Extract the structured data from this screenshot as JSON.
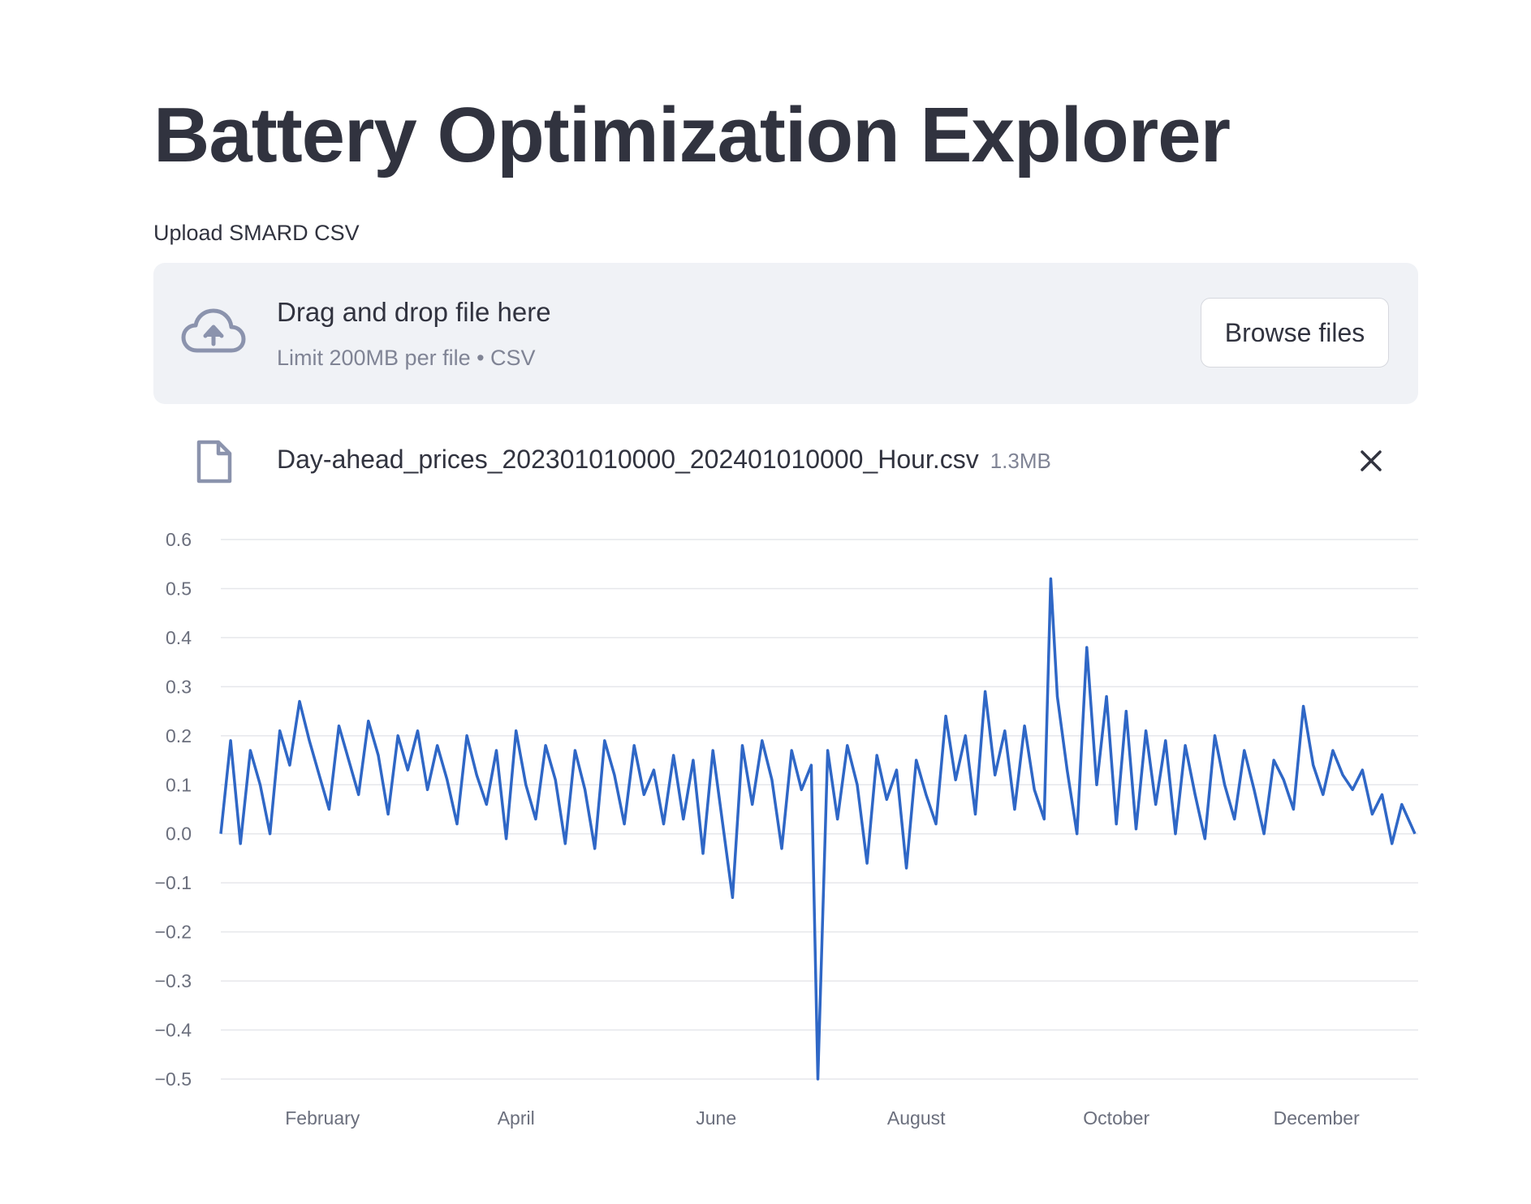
{
  "header": {
    "title": "Battery Optimization Explorer"
  },
  "uploader": {
    "label": "Upload SMARD CSV",
    "drop_text": "Drag and drop file here",
    "limit_text": "Limit 200MB per file • CSV",
    "browse_label": "Browse files",
    "icons": {
      "dropzone": "cloud-upload-icon",
      "file": "file-icon",
      "remove": "close-icon"
    }
  },
  "uploaded_file": {
    "name": "Day-ahead_prices_202301010000_202401010000_Hour.csv",
    "size": "1.3MB"
  },
  "colors": {
    "accent_line": "#2f67c6",
    "dropzone_bg": "#f0f2f6",
    "text": "#31333f",
    "muted_text": "#808495"
  },
  "chart_data": {
    "type": "line",
    "title": "",
    "xlabel": "",
    "ylabel": "",
    "x_range": [
      "2023-01-01",
      "2024-01-01"
    ],
    "ylim": [
      -0.5,
      0.6
    ],
    "y_ticks": [
      0.6,
      0.5,
      0.4,
      0.3,
      0.2,
      0.1,
      0.0,
      -0.1,
      -0.2,
      -0.3,
      -0.4,
      -0.5
    ],
    "y_tick_labels": [
      "0.6",
      "0.5",
      "0.4",
      "0.3",
      "0.2",
      "0.1",
      "0.0",
      "−0.1",
      "−0.2",
      "−0.3",
      "−0.4",
      "−0.5"
    ],
    "x_ticks": [
      {
        "date": "2023-02-01",
        "label": "February"
      },
      {
        "date": "2023-04-01",
        "label": "April"
      },
      {
        "date": "2023-06-01",
        "label": "June"
      },
      {
        "date": "2023-08-01",
        "label": "August"
      },
      {
        "date": "2023-10-01",
        "label": "October"
      },
      {
        "date": "2023-12-01",
        "label": "December"
      }
    ],
    "grid": "horizontal",
    "legend": "none",
    "series": [
      {
        "color": "#2f67c6",
        "x": [
          "2023-01-01",
          "2023-01-04",
          "2023-01-07",
          "2023-01-10",
          "2023-01-13",
          "2023-01-16",
          "2023-01-19",
          "2023-01-22",
          "2023-01-25",
          "2023-01-28",
          "2023-01-31",
          "2023-02-03",
          "2023-02-06",
          "2023-02-09",
          "2023-02-12",
          "2023-02-15",
          "2023-02-18",
          "2023-02-21",
          "2023-02-24",
          "2023-02-27",
          "2023-03-02",
          "2023-03-05",
          "2023-03-08",
          "2023-03-11",
          "2023-03-14",
          "2023-03-17",
          "2023-03-20",
          "2023-03-23",
          "2023-03-26",
          "2023-03-29",
          "2023-04-01",
          "2023-04-04",
          "2023-04-07",
          "2023-04-10",
          "2023-04-13",
          "2023-04-16",
          "2023-04-19",
          "2023-04-22",
          "2023-04-25",
          "2023-04-28",
          "2023-05-01",
          "2023-05-04",
          "2023-05-07",
          "2023-05-10",
          "2023-05-13",
          "2023-05-16",
          "2023-05-19",
          "2023-05-22",
          "2023-05-25",
          "2023-05-28",
          "2023-05-31",
          "2023-06-03",
          "2023-06-06",
          "2023-06-09",
          "2023-06-12",
          "2023-06-15",
          "2023-06-18",
          "2023-06-21",
          "2023-06-24",
          "2023-06-27",
          "2023-06-30",
          "2023-07-02",
          "2023-07-05",
          "2023-07-08",
          "2023-07-11",
          "2023-07-14",
          "2023-07-17",
          "2023-07-20",
          "2023-07-23",
          "2023-07-26",
          "2023-07-29",
          "2023-08-01",
          "2023-08-04",
          "2023-08-07",
          "2023-08-10",
          "2023-08-13",
          "2023-08-16",
          "2023-08-19",
          "2023-08-22",
          "2023-08-25",
          "2023-08-28",
          "2023-08-31",
          "2023-09-03",
          "2023-09-06",
          "2023-09-09",
          "2023-09-11",
          "2023-09-13",
          "2023-09-16",
          "2023-09-19",
          "2023-09-22",
          "2023-09-25",
          "2023-09-28",
          "2023-10-01",
          "2023-10-04",
          "2023-10-07",
          "2023-10-10",
          "2023-10-13",
          "2023-10-16",
          "2023-10-19",
          "2023-10-22",
          "2023-10-25",
          "2023-10-28",
          "2023-10-31",
          "2023-11-03",
          "2023-11-06",
          "2023-11-09",
          "2023-11-12",
          "2023-11-15",
          "2023-11-18",
          "2023-11-21",
          "2023-11-24",
          "2023-11-27",
          "2023-11-30",
          "2023-12-03",
          "2023-12-06",
          "2023-12-09",
          "2023-12-12",
          "2023-12-15",
          "2023-12-18",
          "2023-12-21",
          "2023-12-24",
          "2023-12-27",
          "2023-12-31"
        ],
        "values": [
          0.0,
          0.19,
          -0.02,
          0.17,
          0.1,
          0.0,
          0.21,
          0.14,
          0.27,
          0.19,
          0.12,
          0.05,
          0.22,
          0.15,
          0.08,
          0.23,
          0.16,
          0.04,
          0.2,
          0.13,
          0.21,
          0.09,
          0.18,
          0.11,
          0.02,
          0.2,
          0.12,
          0.06,
          0.17,
          -0.01,
          0.21,
          0.1,
          0.03,
          0.18,
          0.11,
          -0.02,
          0.17,
          0.09,
          -0.03,
          0.19,
          0.12,
          0.02,
          0.18,
          0.08,
          0.13,
          0.02,
          0.16,
          0.03,
          0.15,
          -0.04,
          0.17,
          0.02,
          -0.13,
          0.18,
          0.06,
          0.19,
          0.11,
          -0.03,
          0.17,
          0.09,
          0.14,
          -0.5,
          0.17,
          0.03,
          0.18,
          0.1,
          -0.06,
          0.16,
          0.07,
          0.13,
          -0.07,
          0.15,
          0.08,
          0.02,
          0.24,
          0.11,
          0.2,
          0.04,
          0.29,
          0.12,
          0.21,
          0.05,
          0.22,
          0.09,
          0.03,
          0.52,
          0.28,
          0.13,
          0.0,
          0.38,
          0.1,
          0.28,
          0.02,
          0.25,
          0.01,
          0.21,
          0.06,
          0.19,
          0.0,
          0.18,
          0.08,
          -0.01,
          0.2,
          0.1,
          0.03,
          0.17,
          0.09,
          0.0,
          0.15,
          0.11,
          0.05,
          0.26,
          0.14,
          0.08,
          0.17,
          0.12,
          0.09,
          0.13,
          0.04,
          0.08,
          -0.02,
          0.06,
          0.0
        ]
      }
    ]
  }
}
